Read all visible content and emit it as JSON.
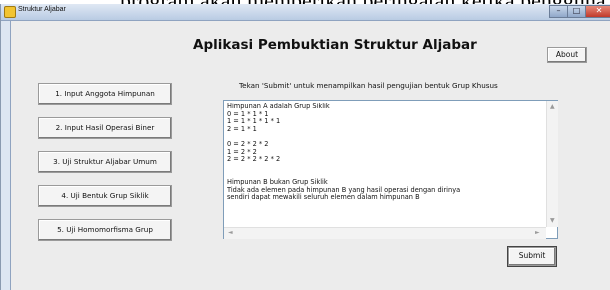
{
  "caption_text": "program akan memberikan peringatan ketika pengguna m",
  "window": {
    "title": "Struktur Aljabar",
    "controls": {
      "minimize": "–",
      "maximize": "□",
      "close": "✕"
    }
  },
  "header": {
    "title": "Aplikasi Pembuktian Struktur Aljabar",
    "about_label": "About"
  },
  "menu": [
    {
      "label": "1. Input Anggota Himpunan"
    },
    {
      "label": "2. Input Hasil Operasi Biner"
    },
    {
      "label": "3. Uji Struktur Aljabar Umum"
    },
    {
      "label": "4. Uji Bentuk Grup Siklik"
    },
    {
      "label": "5. Uji Homomorfisma Grup"
    }
  ],
  "main": {
    "instruction": "Tekan 'Submit' untuk menampilkan hasil pengujian bentuk Grup Khusus",
    "output": "Himpunan A adalah Grup Siklik\n0 = 1 * 1 * 1\n1 = 1 * 1 * 1 * 1\n2 = 1 * 1\n\n0 = 2 * 2 * 2\n1 = 2 * 2\n2 = 2 * 2 * 2 * 2\n\n\nHimpunan B bukan Grup Siklik\nTidak ada elemen pada himpunan B yang hasil operasi dengan dirinya\nsendiri dapat mewakili seluruh elemen dalam himpunan B",
    "submit_label": "Submit"
  },
  "icons": {
    "app": "app-icon",
    "scroll_up": "▲",
    "scroll_down": "▼",
    "scroll_left": "◄",
    "scroll_right": "►"
  },
  "colors": {
    "titlebar": "#b9cbe3",
    "close_button": "#c0392b",
    "window_bg": "#ececec",
    "output_border": "#7f9db9"
  }
}
